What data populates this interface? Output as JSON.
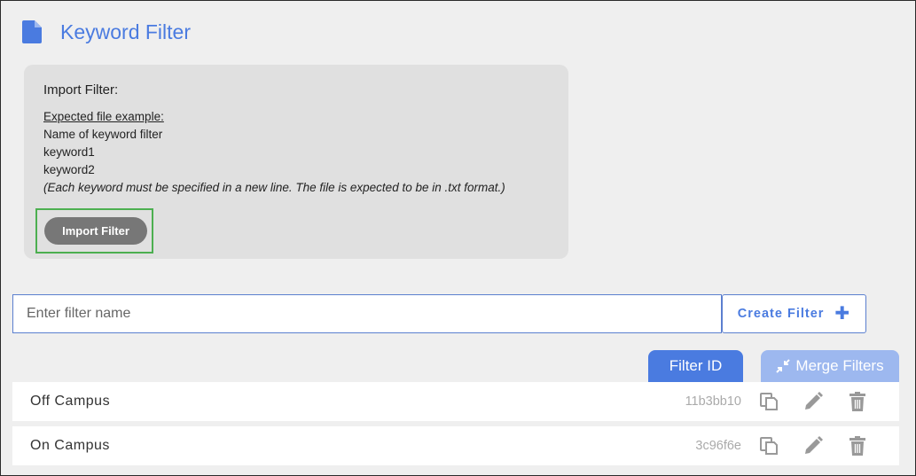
{
  "page": {
    "title": "Keyword Filter",
    "title_icon": "document-icon",
    "accent_color": "#4a7be0"
  },
  "import_panel": {
    "title": "Import Filter:",
    "example_heading": "Expected file example:",
    "example_lines": [
      "Name of keyword filter",
      "keyword1",
      "keyword2"
    ],
    "note": "(Each keyword must be specified in a new line. The file is expected to be in .txt format.)",
    "button_label": "Import Filter"
  },
  "create": {
    "placeholder": "Enter filter name",
    "button_label": "Create Filter",
    "button_icon": "plus-icon"
  },
  "tabs": {
    "filter_id_label": "Filter ID",
    "merge_label": "Merge Filters",
    "merge_icon": "compress-arrows-icon"
  },
  "filters": [
    {
      "name": "Off Campus",
      "id": "11b3bb10"
    },
    {
      "name": "On Campus",
      "id": "3c96f6e"
    }
  ],
  "row_actions": [
    "copy-icon",
    "edit-pencil-icon",
    "trash-icon"
  ]
}
